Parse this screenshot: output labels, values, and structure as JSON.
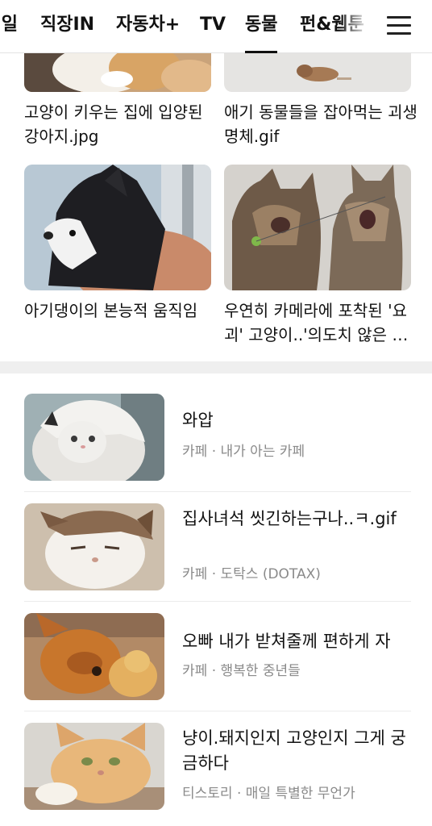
{
  "nav": {
    "tabs": [
      {
        "label": "일"
      },
      {
        "label": "직장IN"
      },
      {
        "label": "자동차+"
      },
      {
        "label": "TV"
      },
      {
        "label": "동물"
      },
      {
        "label": "펀&웹툰"
      }
    ],
    "active_tab": "동물",
    "menu_icon": "hamburger-menu-icon"
  },
  "grid": [
    {
      "title": "고양이 키우는 집에 입양된 강아지.jpg"
    },
    {
      "title": "애기 동물들을 잡아먹는 괴생명체.gif"
    },
    {
      "title": "아기댕이의 본능적 움직임"
    },
    {
      "title": "우연히 카메라에 포착된 '요괴' 고양이..'의도치 않은 명장면'"
    }
  ],
  "list": [
    {
      "title": "와압",
      "source": "카페",
      "sep": "·",
      "author": "내가 아는 카페"
    },
    {
      "title": "집사녀석 씻긴하는구나..ㅋ.gif",
      "source": "카페",
      "sep": "·",
      "author": "도탁스 (DOTAX)"
    },
    {
      "title": "오빠 내가 받쳐줄께 편하게 자",
      "source": "카페",
      "sep": "·",
      "author": "행복한 중년들"
    },
    {
      "title": "냥이.돼지인지 고양인지 그게 궁금하다",
      "source": "티스토리",
      "sep": "·",
      "author": "매일 특별한 무언가"
    }
  ]
}
